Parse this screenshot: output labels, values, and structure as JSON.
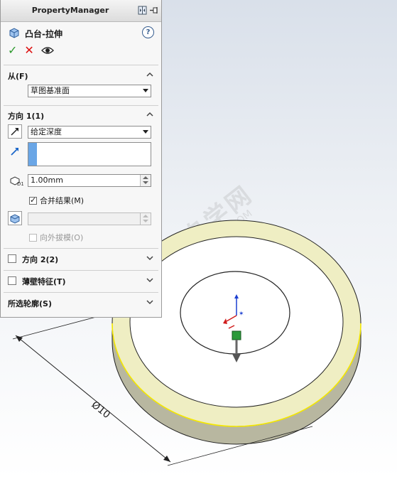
{
  "panel": {
    "title": "PropertyManager",
    "feature_name": "凸台-拉伸",
    "help_glyph": "?",
    "ok_glyph": "✓",
    "cancel_glyph": "✕"
  },
  "from_section": {
    "label": "从(F)",
    "selected": "草图基准面"
  },
  "direction1": {
    "label": "方向 1(1)",
    "end_condition": "给定深度",
    "depth_value": "1.00mm",
    "merge_label": "合并结果(M)",
    "merge_checked": true,
    "draft_outward_label": "向外拔模(O)",
    "draft_outward_checked": false
  },
  "direction2": {
    "label": "方向 2(2)",
    "checked": false
  },
  "thin_feature": {
    "label": "薄壁特征(T)",
    "checked": false
  },
  "selected_contours": {
    "label": "所选轮廓(S)"
  },
  "viewport": {
    "dimension_label": "Ø10",
    "watermark": "软件自学网",
    "watermark_url": "WWW.RJZXW.COM",
    "colors": {
      "ring_top": "#efeec3",
      "ring_side": "#b8b7a0",
      "edge_highlight": "#f5e800",
      "accent_blue": "#1b66c9"
    }
  }
}
